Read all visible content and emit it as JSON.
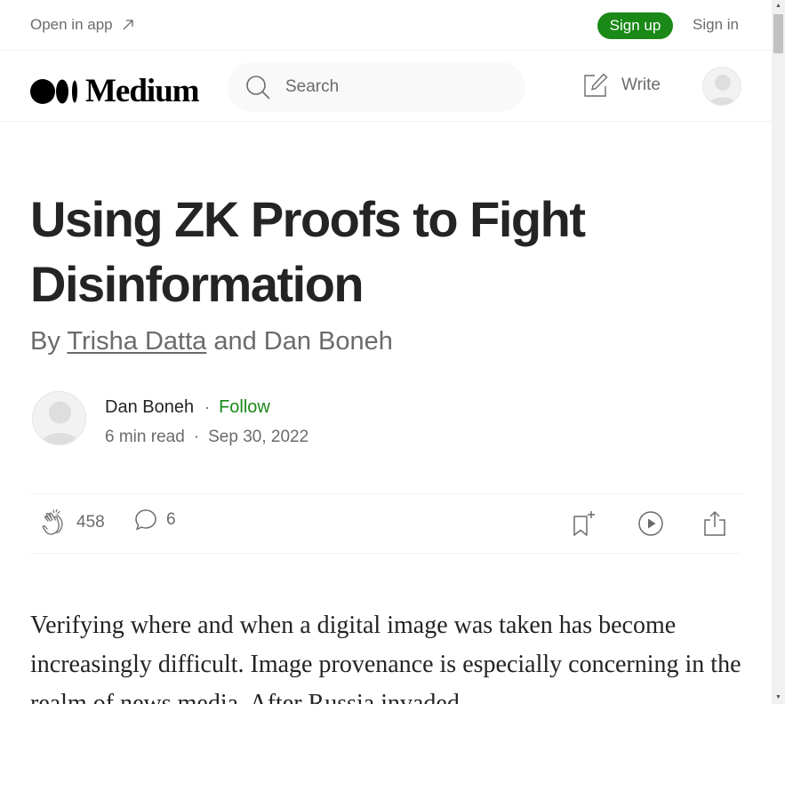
{
  "topbar": {
    "open_in_app": "Open in app",
    "sign_up": "Sign up",
    "sign_in": "Sign in"
  },
  "header": {
    "logo_text": "Medium",
    "search_placeholder": "Search",
    "write_label": "Write"
  },
  "article": {
    "title": "Using ZK Proofs to Fight Disinformation",
    "byline_prefix": "By",
    "byline_author1": "Trisha Datta",
    "byline_joiner": "and Dan Boneh",
    "author_name": "Dan Boneh",
    "follow_label": "Follow",
    "read_time": "6 min read",
    "date": "Sep 30, 2022",
    "claps": "458",
    "comments": "6",
    "body": "Verifying where and when a digital image was taken has become increasingly difficult. Image provenance is especially concerning in the realm of news media. After Russia invaded"
  },
  "colors": {
    "accent_green": "#1a8917",
    "text_primary": "#242424",
    "text_secondary": "#6b6b6b"
  },
  "icons": [
    "arrow-up-right-icon",
    "medium-logo-icon",
    "search-icon",
    "write-icon",
    "avatar-placeholder-icon",
    "clap-icon",
    "comment-icon",
    "bookmark-add-icon",
    "play-icon",
    "share-icon"
  ]
}
